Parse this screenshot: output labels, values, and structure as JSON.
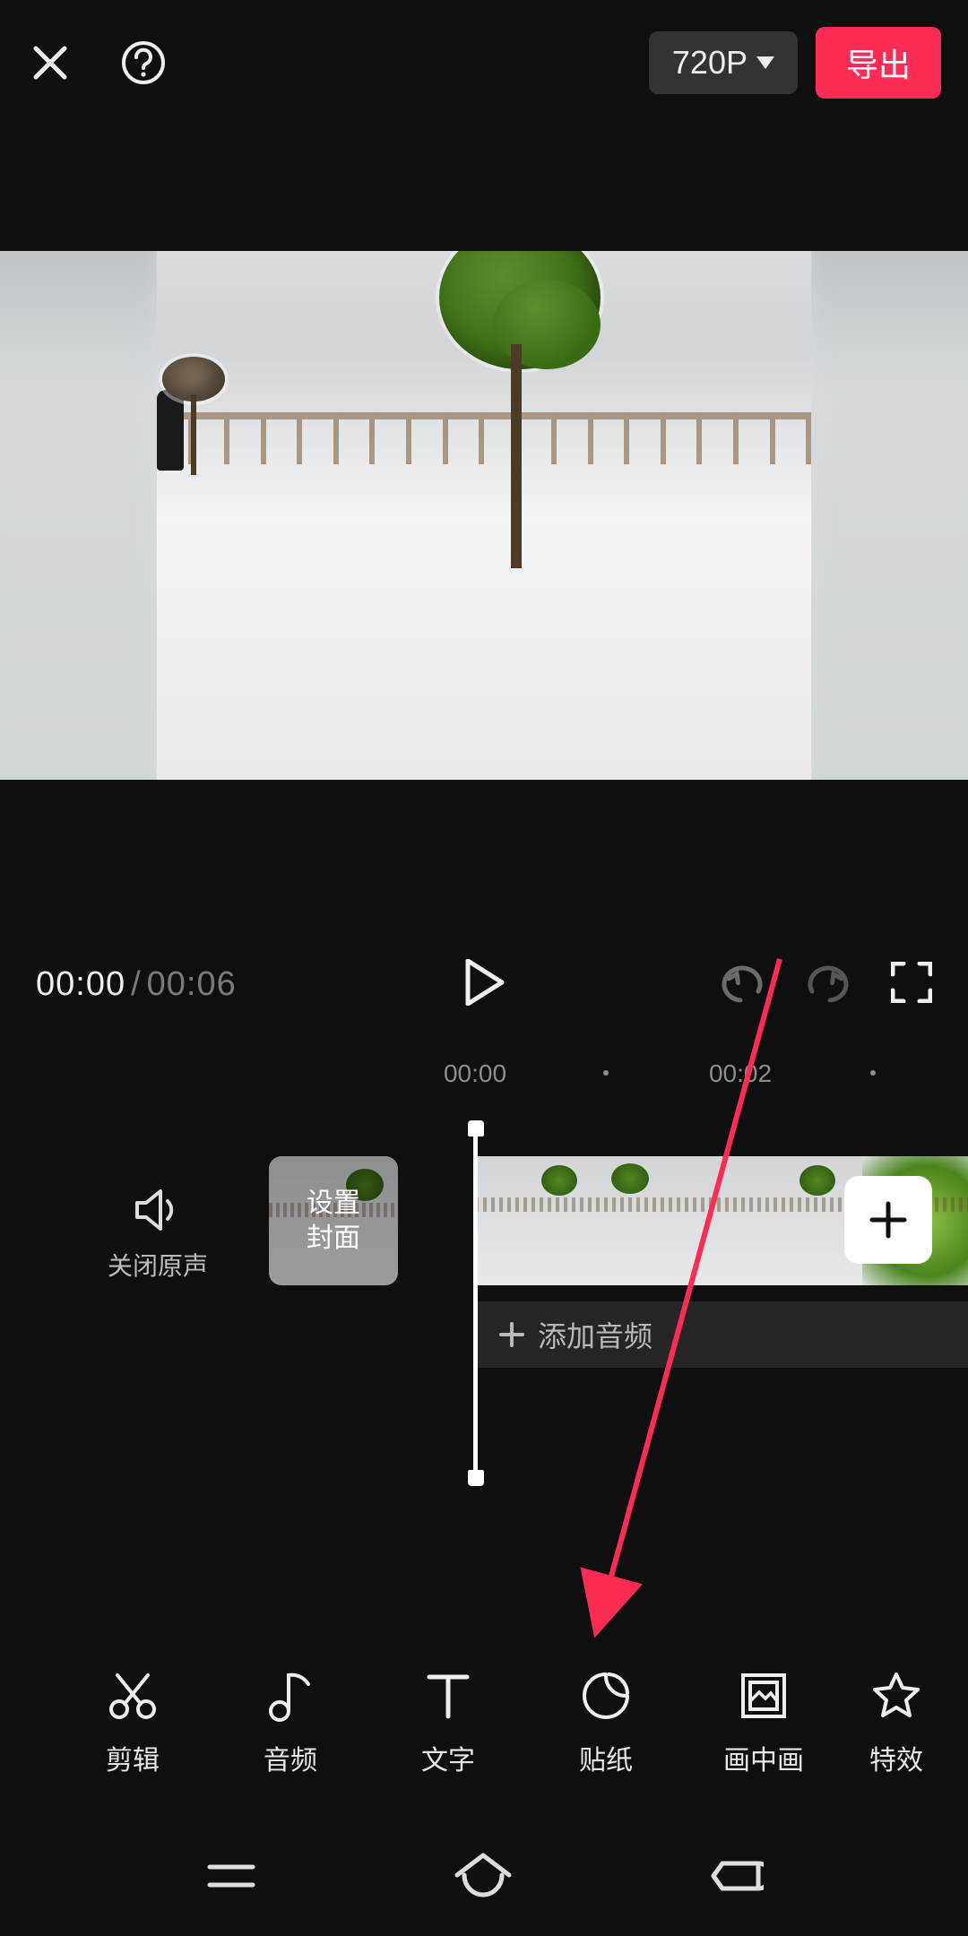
{
  "header": {
    "resolution_label": "720P",
    "export_label": "导出"
  },
  "playback": {
    "current": "00:00",
    "duration": "00:06"
  },
  "ruler": {
    "marks": [
      "00:00",
      "00:02"
    ]
  },
  "timeline": {
    "mute_label": "关闭原声",
    "cover_label": "设置\n封面",
    "add_audio_label": "添加音频"
  },
  "tools": [
    {
      "id": "edit",
      "label": "剪辑"
    },
    {
      "id": "audio",
      "label": "音频"
    },
    {
      "id": "text",
      "label": "文字"
    },
    {
      "id": "sticker",
      "label": "贴纸"
    },
    {
      "id": "pip",
      "label": "画中画"
    },
    {
      "id": "effects",
      "label": "特效"
    }
  ],
  "annotation": {
    "target_tool": "sticker",
    "color": "#fc2c55"
  }
}
